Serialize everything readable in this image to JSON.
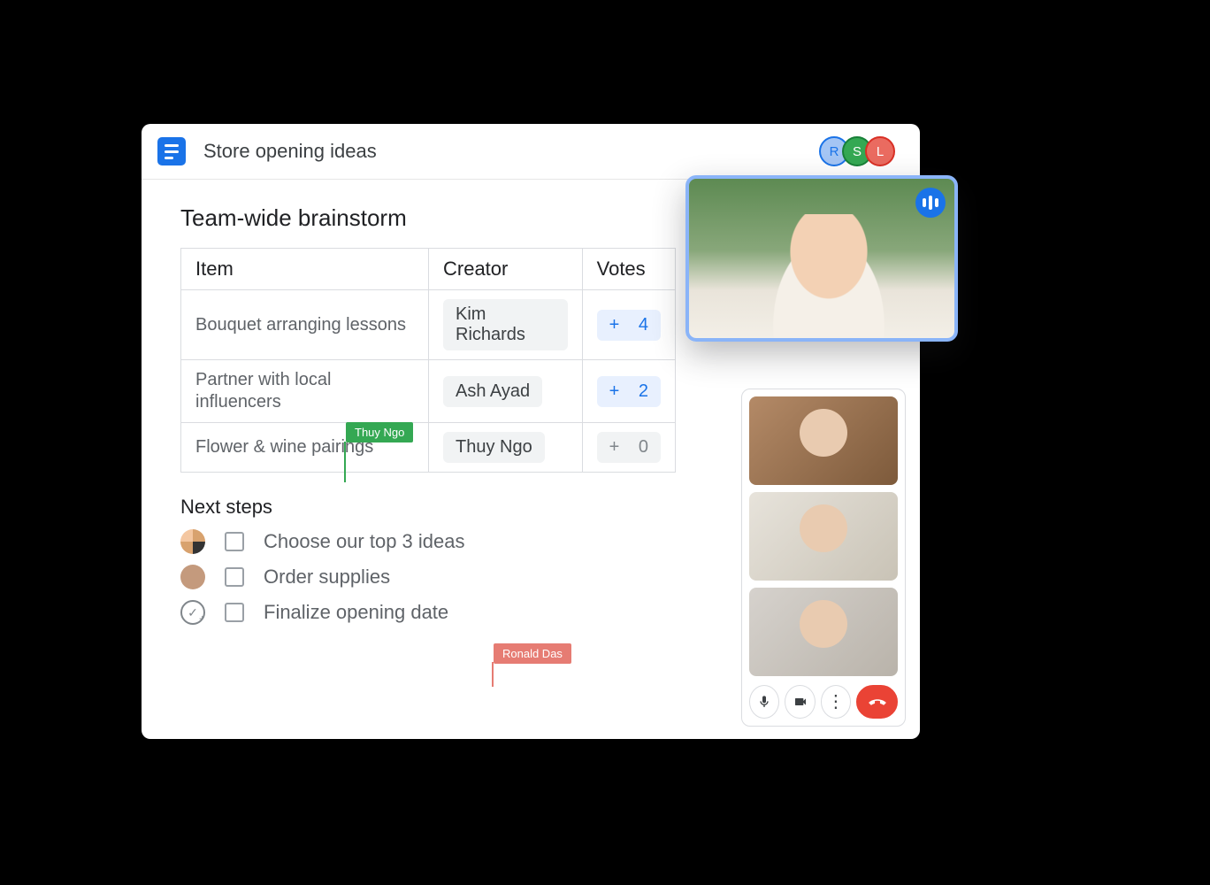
{
  "header": {
    "doc_title": "Store opening ideas",
    "collaborators": [
      {
        "initial": "R",
        "class": "r"
      },
      {
        "initial": "S",
        "class": "s"
      },
      {
        "initial": "L",
        "class": "l"
      }
    ]
  },
  "doc": {
    "heading_brainstorm": "Team-wide brainstorm",
    "table": {
      "columns": {
        "item": "Item",
        "creator": "Creator",
        "votes": "Votes"
      },
      "rows": [
        {
          "item": "Bouquet arranging lessons",
          "creator": "Kim Richards",
          "votes_label": "4",
          "votes_prefix": "+",
          "active": true
        },
        {
          "item": "Partner with local influencers",
          "creator": "Ash Ayad",
          "votes_label": "2",
          "votes_prefix": "+",
          "active": true
        },
        {
          "item": "Flower & wine pairings",
          "creator": "Thuy Ngo",
          "votes_label": "0",
          "votes_prefix": "+",
          "active": false
        }
      ]
    },
    "cursors": {
      "green_name": "Thuy Ngo",
      "red_name": "Ronald Das"
    },
    "next_steps_heading": "Next steps",
    "next_steps": [
      {
        "label": "Choose our top 3 ideas",
        "assignee_class": "group"
      },
      {
        "label": "Order supplies",
        "assignee_class": "a2"
      },
      {
        "label": "Finalize opening date",
        "assignee_class": "add"
      }
    ]
  },
  "meet": {
    "controls": {
      "mic_glyph": "🎤",
      "cam_glyph": "🎥",
      "more_glyph": "⋮",
      "hangup_glyph": "📞"
    }
  }
}
